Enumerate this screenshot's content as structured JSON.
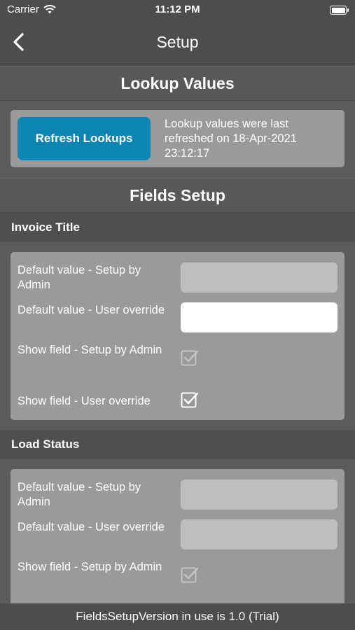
{
  "status_bar": {
    "carrier": "Carrier",
    "time": "11:12 PM"
  },
  "nav": {
    "title": "Setup"
  },
  "lookup": {
    "header": "Lookup Values",
    "refresh_label": "Refresh Lookups",
    "info": "Lookup values were last refreshed on 18-Apr-2021 23:12:17"
  },
  "fields_setup": {
    "header": "Fields Setup"
  },
  "groups": [
    {
      "title": "Invoice Title",
      "rows": {
        "default_admin_label": "Default value - Setup by Admin",
        "default_admin_value": "",
        "default_user_label": "Default value - User override",
        "default_user_value": "",
        "show_admin_label": "Show field - Setup by Admin",
        "show_user_label": "Show field - User override"
      }
    },
    {
      "title": "Load Status",
      "rows": {
        "default_admin_label": "Default value - Setup by Admin",
        "default_admin_value": "",
        "default_user_label": "Default value - User override",
        "default_user_value": "",
        "show_admin_label": "Show field - Setup by Admin"
      }
    }
  ],
  "footer": {
    "text": "FieldsSetupVersion in use is 1.0 (Trial)"
  }
}
